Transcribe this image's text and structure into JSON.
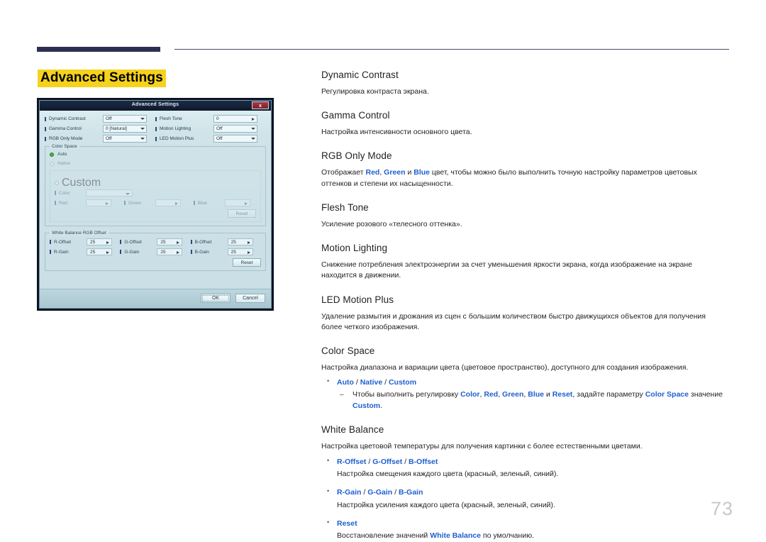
{
  "page": {
    "title": "Advanced Settings",
    "number": "73",
    "accent_highlight": "#f5d21e",
    "rule_color": "#2e2f50",
    "link_color": "#1f5fd0"
  },
  "dialog": {
    "title": "Advanced Settings",
    "close_label": "x",
    "rows": [
      {
        "label": "Dynamic Contrast",
        "value": "Off",
        "label2": "Flesh Tone",
        "value2": "0",
        "type2": "spin"
      },
      {
        "label": "Gamma Control",
        "value": "0 [Natural]",
        "label2": "Motion Lighting",
        "value2": "Off",
        "type2": "combo"
      },
      {
        "label": "RGB Only Mode",
        "value": "Off",
        "label2": "LED Motion Plus",
        "value2": "Off",
        "type2": "combo"
      }
    ],
    "color_space": {
      "group_label": "Color Space",
      "options": [
        {
          "label": "Auto",
          "selected": true
        },
        {
          "label": "Native",
          "selected": false
        },
        {
          "label": "Custom",
          "selected": false
        }
      ],
      "custom": {
        "color_label": "Color",
        "color_value": "",
        "red_label": "Red",
        "red_value": "",
        "green_label": "Green",
        "green_value": "",
        "blue_label": "Blue",
        "blue_value": "",
        "reset_label": "Reset"
      }
    },
    "white_balance": {
      "group_label": "White Balance RGB Offset",
      "cells": [
        {
          "label": "R-Offset",
          "value": "25"
        },
        {
          "label": "G-Offset",
          "value": "25"
        },
        {
          "label": "B-Offset",
          "value": "25"
        },
        {
          "label": "R-Gain",
          "value": "25"
        },
        {
          "label": "G-Gain",
          "value": "25"
        },
        {
          "label": "B-Gain",
          "value": "25"
        }
      ],
      "reset_label": "Reset"
    },
    "footer": {
      "ok_label": "OK",
      "cancel_label": "Cancel"
    }
  },
  "sections": {
    "dynamic_contrast": {
      "title": "Dynamic Contrast",
      "body": "Регулировка контраста экрана."
    },
    "gamma_control": {
      "title": "Gamma Control",
      "body": "Настройка интенсивности основного цвета."
    },
    "rgb_only_mode": {
      "title": "RGB Only Mode",
      "body_1": "Отображает ",
      "kw_red": "Red",
      "body_2": ", ",
      "kw_green": "Green",
      "body_3": " и ",
      "kw_blue": "Blue",
      "body_4": " цвет, чтобы можно было выполнить точную настройку параметров цветовых оттенков и степени их насыщенности."
    },
    "flesh_tone": {
      "title": "Flesh Tone",
      "body": "Усиление розового «телесного оттенка»."
    },
    "motion_lighting": {
      "title": "Motion Lighting",
      "body": "Снижение потребления электроэнергии за счет уменьшения яркости экрана, когда изображение на экране находится в движении."
    },
    "led_motion_plus": {
      "title": "LED Motion Plus",
      "body": "Удаление размытия и дрожания из сцен с большим количеством быстро движущихся объектов для получения более четкого изображения."
    },
    "color_space": {
      "title": "Color Space",
      "body": "Настройка диапазона и вариации цвета (цветовое пространство), доступного для создания изображения.",
      "bullet": {
        "a": "Auto",
        "sep1": " / ",
        "b": "Native",
        "sep2": " / ",
        "c": "Custom"
      },
      "sub": {
        "t1": "Чтобы выполнить регулировку ",
        "k1": "Color",
        "s1": ", ",
        "k2": "Red",
        "s2": ", ",
        "k3": "Green",
        "s3": ", ",
        "k4": "Blue",
        "s4": " и ",
        "k5": "Reset",
        "s5": ", задайте параметру ",
        "k6": "Color Space",
        "s6": " значение ",
        "k7": "Custom",
        "s7": "."
      }
    },
    "white_balance": {
      "title": "White Balance",
      "body": "Настройка цветовой температуры для получения картинки с более естественными цветами.",
      "items": [
        {
          "keys": [
            "R-Offset",
            "G-Offset",
            "B-Offset"
          ],
          "desc": "Настройка смещения каждого цвета (красный, зеленый, синий)."
        },
        {
          "keys": [
            "R-Gain",
            "G-Gain",
            "B-Gain"
          ],
          "desc": "Настройка усиления каждого цвета (красный, зеленый, синий)."
        }
      ],
      "reset": {
        "key": "Reset",
        "desc_1": "Восстановление значений ",
        "kw": "White Balance",
        "desc_2": " по умолчанию."
      }
    }
  }
}
